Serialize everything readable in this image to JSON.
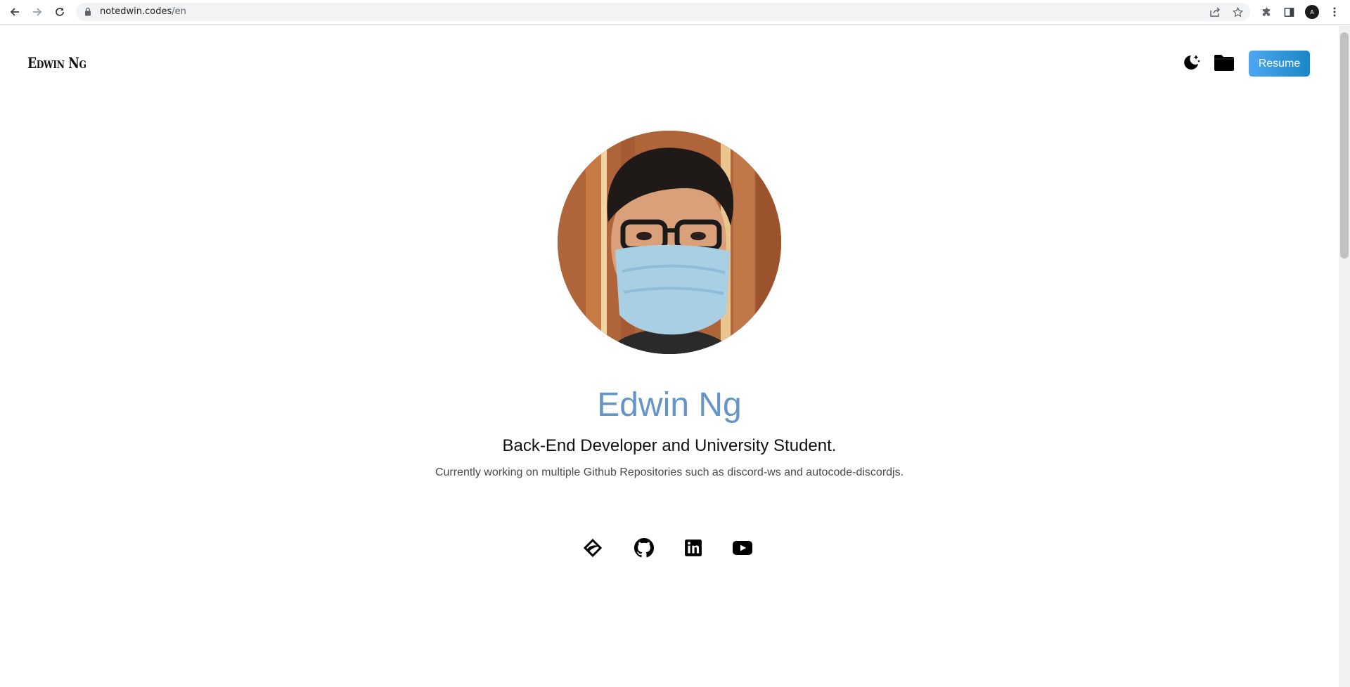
{
  "browser": {
    "url_host": "notedwin.codes",
    "url_path": "/en",
    "profile_initials": "A"
  },
  "header": {
    "brand": "Edwin Ng",
    "resume_label": "Resume"
  },
  "hero": {
    "name": "Edwin Ng",
    "subtitle": "Back-End Developer and University Student.",
    "description": "Currently working on multiple Github Repositories such as discord-ws and autocode-discordjs."
  },
  "icons": {
    "theme_toggle": "moon-stars-icon",
    "projects": "folder-icon",
    "social": [
      "autocode-icon",
      "github-icon",
      "linkedin-icon",
      "youtube-icon"
    ]
  },
  "colors": {
    "name": "#6495c8",
    "resume_start": "#4fa6f0",
    "resume_end": "#1a87c6"
  }
}
